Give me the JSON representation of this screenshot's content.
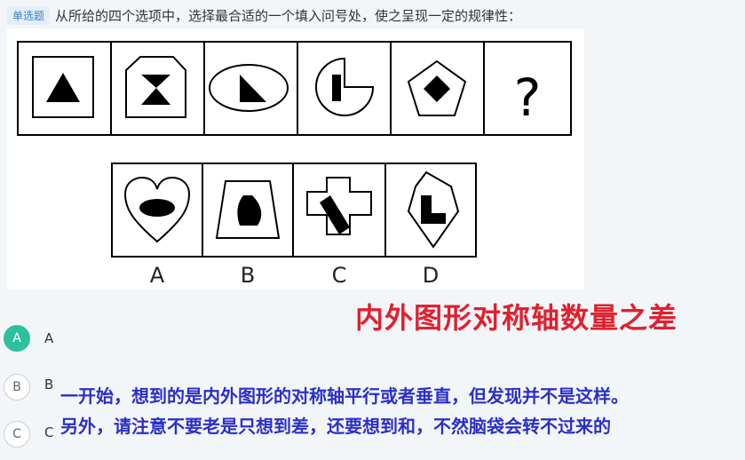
{
  "question": {
    "type_tag": "单选题",
    "text": "从所给的四个选项中，选择最合适的一个填入问号处，使之呈现一定的规律性："
  },
  "figure": {
    "question_mark": "?",
    "option_letters": [
      "A",
      "B",
      "C",
      "D"
    ]
  },
  "annotation": {
    "title": "内外图形对称轴数量之差",
    "note_line1": "一开始，想到的是内外图形的对称轴平行或者垂直，但发现并不是这样。",
    "note_line2": "另外，请注意不要老是只想到差，还要想到和，不然脑袋会转不过来的"
  },
  "options": [
    {
      "radio": "A",
      "label": "A",
      "selected": true
    },
    {
      "radio": "B",
      "label": "B",
      "selected": false
    },
    {
      "radio": "C",
      "label": "C",
      "selected": false
    }
  ],
  "colors": {
    "accent_green": "#2cc09c",
    "annotation_red": "#e0212f",
    "annotation_blue": "#2b2fc8"
  }
}
